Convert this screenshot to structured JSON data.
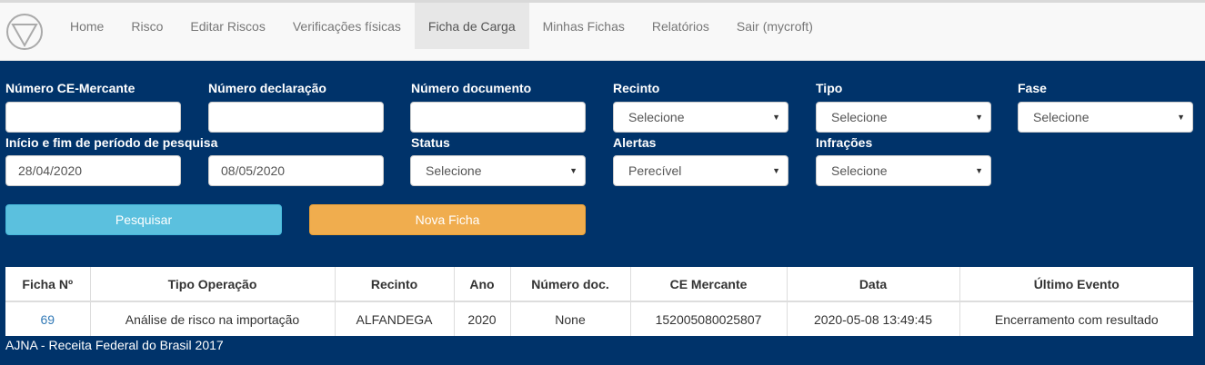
{
  "nav": {
    "items": [
      {
        "label": "Home"
      },
      {
        "label": "Risco"
      },
      {
        "label": "Editar Riscos"
      },
      {
        "label": "Verificações físicas"
      },
      {
        "label": "Ficha de Carga"
      },
      {
        "label": "Minhas Fichas"
      },
      {
        "label": "Relatórios"
      },
      {
        "label": "Sair (mycroft)"
      }
    ],
    "active": "Ficha de Carga"
  },
  "form": {
    "numero_ce": {
      "label": "Número CE-Mercante",
      "value": ""
    },
    "numero_declaracao": {
      "label": "Número declaração",
      "value": ""
    },
    "numero_documento": {
      "label": "Número documento",
      "value": ""
    },
    "recinto": {
      "label": "Recinto",
      "value": "Selecione"
    },
    "tipo": {
      "label": "Tipo",
      "value": "Selecione"
    },
    "fase": {
      "label": "Fase",
      "value": "Selecione"
    },
    "periodo": {
      "label": "Início e fim de período de pesquisa",
      "inicio": "28/04/2020",
      "fim": "08/05/2020"
    },
    "status": {
      "label": "Status",
      "value": "Selecione"
    },
    "alertas": {
      "label": "Alertas",
      "value": "Perecível"
    },
    "infracoes": {
      "label": "Infrações",
      "value": "Selecione"
    }
  },
  "buttons": {
    "search": "Pesquisar",
    "new_ficha": "Nova Ficha"
  },
  "table": {
    "headers": [
      "Ficha Nº",
      "Tipo Operação",
      "Recinto",
      "Ano",
      "Número doc.",
      "CE Mercante",
      "Data",
      "Último Evento"
    ],
    "rows": [
      [
        "69",
        "Análise de risco na importação",
        "ALFANDEGA",
        "2020",
        "None",
        "152005080025807",
        "2020-05-08 13:49:45",
        "Encerramento com resultado"
      ]
    ]
  },
  "footer": "AJNA - Receita Federal do Brasil 2017",
  "icons": {
    "logo": "triangle-circle-logo-icon",
    "select_caret": "caret-down-icon"
  },
  "colors": {
    "main_bg": "#00336a",
    "search_btn": "#5bc0de",
    "new_btn": "#f0ad4e",
    "link": "#337ab7"
  }
}
